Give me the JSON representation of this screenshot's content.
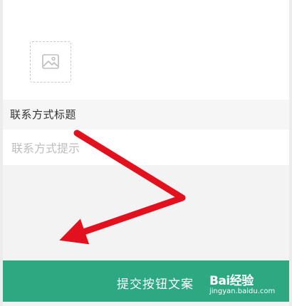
{
  "upload": {
    "icon": "image-placeholder-icon"
  },
  "contact": {
    "title": "联系方式标题",
    "placeholder": "联系方式提示"
  },
  "submit": {
    "label": "提交按钮文案"
  },
  "watermark": {
    "brand": "Bai经验",
    "url": "jingyan.baidu.com"
  },
  "colors": {
    "accent": "#2da880",
    "arrow": "#e3101e"
  }
}
